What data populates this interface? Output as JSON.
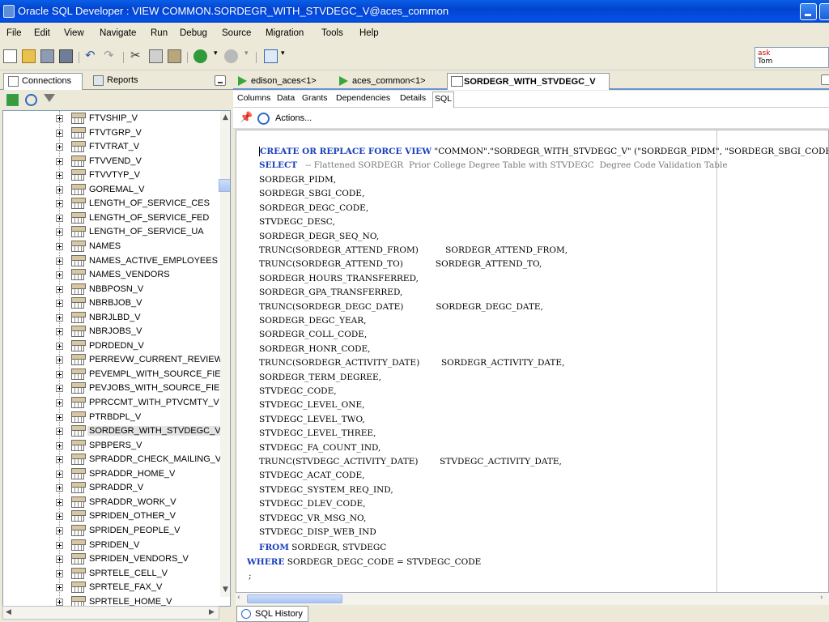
{
  "window": {
    "title": "Oracle SQL Developer : VIEW COMMON.SORDEGR_WITH_STVDEGC_V@aces_common"
  },
  "menu": {
    "file": "File",
    "edit": "Edit",
    "view": "View",
    "navigate": "Navigate",
    "run": "Run",
    "debug": "Debug",
    "source": "Source",
    "migration": "Migration",
    "tools": "Tools",
    "help": "Help"
  },
  "ask": {
    "line1": "ask",
    "line2": "Tom"
  },
  "left": {
    "tabs": {
      "connections": "Connections",
      "reports": "Reports"
    },
    "tree": [
      "FTVSHIP_V",
      "FTVTGRP_V",
      "FTVTRAT_V",
      "FTVVEND_V",
      "FTVVTYP_V",
      "GOREMAL_V",
      "LENGTH_OF_SERVICE_CES",
      "LENGTH_OF_SERVICE_FED",
      "LENGTH_OF_SERVICE_UA",
      "NAMES",
      "NAMES_ACTIVE_EMPLOYEES",
      "NAMES_VENDORS",
      "NBBPOSN_V",
      "NBRBJOB_V",
      "NBRJLBD_V",
      "NBRJOBS_V",
      "PDRDEDN_V",
      "PERREVW_CURRENT_REVIEW_V",
      "PEVEMPL_WITH_SOURCE_FIELD",
      "PEVJOBS_WITH_SOURCE_FIELD",
      "PPRCCMT_WITH_PTVCMTY_V",
      "PTRBDPL_V",
      "SORDEGR_WITH_STVDEGC_V",
      "SPBPERS_V",
      "SPRADDR_CHECK_MAILING_V",
      "SPRADDR_HOME_V",
      "SPRADDR_V",
      "SPRADDR_WORK_V",
      "SPRIDEN_OTHER_V",
      "SPRIDEN_PEOPLE_V",
      "SPRIDEN_V",
      "SPRIDEN_VENDORS_V",
      "SPRTELE_CELL_V",
      "SPRTELE_FAX_V",
      "SPRTELE_HOME_V"
    ],
    "selected": "SORDEGR_WITH_STVDEGC_V"
  },
  "editor": {
    "tabs": {
      "t1": "edison_aces<1>",
      "t2": "aces_common<1>",
      "t3": "SORDEGR_WITH_STVDEGC_V"
    },
    "subtabs": {
      "columns": "Columns",
      "data": "Data",
      "grants": "Grants",
      "dependencies": "Dependencies",
      "details": "Details",
      "sql": "SQL"
    },
    "actions": "Actions...",
    "code": {
      "l0": {
        "k": "CREATE OR REPLACE FORCE VIEW",
        "t": " \"COMMON\".\"SORDEGR_WITH_STVDEGC_V\" (\"SORDEGR_PIDM\", \"SORDEGR_SBGI_CODE\""
      },
      "l1": {
        "k": "SELECT",
        "c": "   -- Flattened SORDEGR  Prior College Degree Table with STVDEGC  Degree Code Validation Table"
      },
      "lines": [
        "SORDEGR_PIDM,",
        "SORDEGR_SBGI_CODE,",
        "SORDEGR_DEGC_CODE,",
        "STVDEGC_DESC,",
        "SORDEGR_DEGR_SEQ_NO,",
        "TRUNC(SORDEGR_ATTEND_FROM)          SORDEGR_ATTEND_FROM,",
        "TRUNC(SORDEGR_ATTEND_TO)            SORDEGR_ATTEND_TO,",
        "SORDEGR_HOURS_TRANSFERRED,",
        "SORDEGR_GPA_TRANSFERRED,",
        "TRUNC(SORDEGR_DEGC_DATE)            SORDEGR_DEGC_DATE,",
        "SORDEGR_DEGC_YEAR,",
        "SORDEGR_COLL_CODE,",
        "SORDEGR_HONR_CODE,",
        "TRUNC(SORDEGR_ACTIVITY_DATE)        SORDEGR_ACTIVITY_DATE,",
        "SORDEGR_TERM_DEGREE,",
        "STVDEGC_CODE,",
        "STVDEGC_LEVEL_ONE,",
        "STVDEGC_LEVEL_TWO,",
        "STVDEGC_LEVEL_THREE,",
        "STVDEGC_FA_COUNT_IND,",
        "TRUNC(STVDEGC_ACTIVITY_DATE)        STVDEGC_ACTIVITY_DATE,",
        "STVDEGC_ACAT_CODE,",
        "STVDEGC_SYSTEM_REQ_IND,",
        "STVDEGC_DLEV_CODE,",
        "STVDEGC_VR_MSG_NO,",
        "STVDEGC_DISP_WEB_IND"
      ],
      "from": {
        "k": "FROM",
        "t": " SORDEGR, STVDEGC"
      },
      "where": {
        "k": "WHERE",
        "t": " SORDEGR_DEGC_CODE = STVDEGC_CODE"
      },
      "end": ";"
    }
  },
  "bottom": {
    "sql_history": "SQL History"
  },
  "colors": {
    "keyword": "#1a3fbb",
    "comment": "#7a7a7a",
    "titlebar": "#0a5fe6"
  }
}
